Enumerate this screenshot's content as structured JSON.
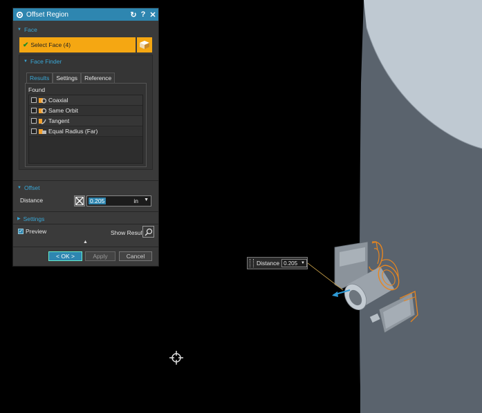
{
  "dialog": {
    "title": "Offset Region",
    "title_buttons": [
      "refresh-icon",
      "help-icon",
      "close-icon"
    ],
    "face_section": {
      "header": "Face",
      "select_label": "Select Face (4)",
      "face_finder": {
        "header": "Face Finder",
        "tabs": [
          "Results",
          "Settings",
          "Reference"
        ],
        "active_tab": "Results",
        "found_label": "Found",
        "items": [
          {
            "label": "Coaxial",
            "checked": false
          },
          {
            "label": "Same Orbit",
            "checked": false
          },
          {
            "label": "Tangent",
            "checked": false
          },
          {
            "label": "Equal Radius (Far)",
            "checked": false
          }
        ]
      }
    },
    "offset_section": {
      "header": "Offset",
      "distance_label": "Distance",
      "distance_value": "0.205",
      "distance_unit": "in"
    },
    "settings_section": {
      "header": "Settings",
      "preview_label": "Preview",
      "preview_checked": true,
      "show_result_label": "Show Result"
    },
    "buttons": {
      "ok": "< OK >",
      "apply": "Apply",
      "cancel": "Cancel"
    }
  },
  "floating_distance": {
    "label": "Distance",
    "value": "0.205"
  },
  "colors": {
    "accent": "#2e86b0",
    "section_header": "#39a7d6",
    "selection": "#f5a712",
    "highlight_edges": "#e8861f",
    "model_body": "#5b6570"
  }
}
